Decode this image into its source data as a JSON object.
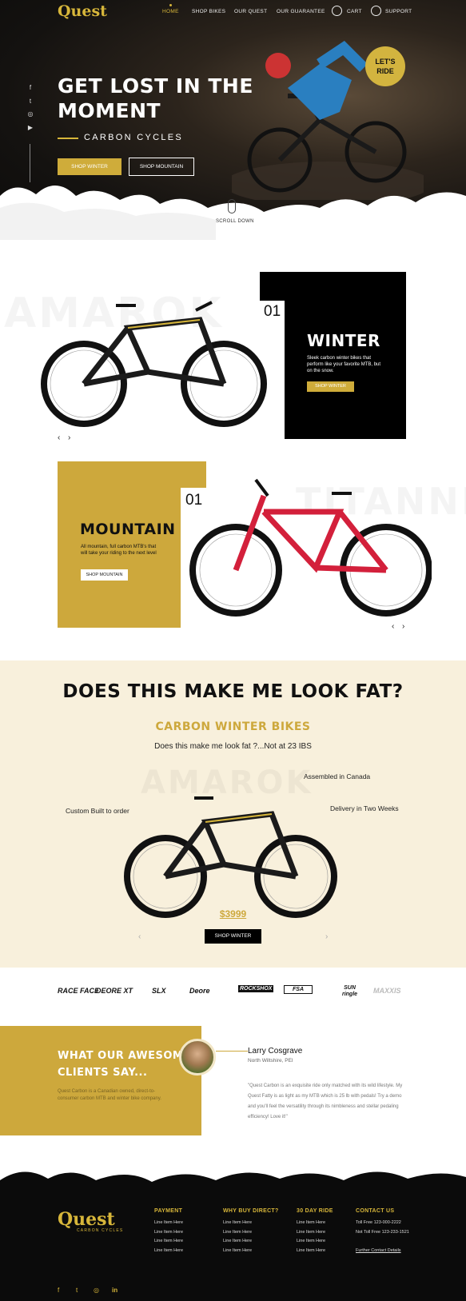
{
  "brand": {
    "logo_text": "Quest",
    "tagline": "CARBON CYCLES"
  },
  "nav": {
    "items": [
      "HOME",
      "SHOP BIKES",
      "OUR QUEST",
      "OUR GUARANTEE"
    ],
    "cart": "CART",
    "support": "SUPPORT"
  },
  "hero": {
    "title_line1": "GET LOST IN THE",
    "title_line2": "MOMENT",
    "subtitle": "CARBON CYCLES",
    "btn_winter": "SHOP WINTER",
    "btn_mountain": "SHOP MOUNTAIN",
    "badge_line1": "LET'S",
    "badge_line2": "RIDE",
    "scroll": "SCROLL DOWN",
    "social_icons": [
      "facebook-icon",
      "twitter-icon",
      "instagram-icon",
      "youtube-icon"
    ]
  },
  "winter": {
    "ghost": "AMAROK",
    "number": "01",
    "title": "WINTER",
    "text": "Sleek carbon winter bikes that perform like your favorite MTB, but on the snow.",
    "button": "SHOP WINTER"
  },
  "mountain": {
    "ghost": "TITANNI",
    "number": "01",
    "title": "MOUNTAIN",
    "text": "All mountain, full carbon MTB's that will take your riding to the next level",
    "button": "SHOP MOUNTAIN"
  },
  "fat": {
    "heading": "DOES THIS MAKE ME LOOK FAT?",
    "subheading": "CARBON WINTER BIKES",
    "tagline": "Does this make me look fat ?...Not at 23 IBS",
    "ghost": "AMAROK",
    "feature_left": "Custom Built to order",
    "feature_top": "Assembled in Canada",
    "feature_right": "Delivery in Two Weeks",
    "price": "$3999",
    "button": "SHOP WINTER"
  },
  "brands": [
    "RACE FACE",
    "DEORE XT",
    "SLX",
    "Deore",
    "ROCKSHOX",
    "FSA",
    "SUN ringle",
    "MAXXIS"
  ],
  "testimonial": {
    "heading_line1": "WHAT OUR AWESOME",
    "heading_line2": "CLIENTS SAY...",
    "intro": "Quest Carbon is a Canadian owned, direct-to-consumer carbon MTB and winter bike company.",
    "name": "Larry Cosgrave",
    "location": "North Wiltshire, PEI",
    "quote": "\"Quest Carbon is an exquisite ride only matched with its wild lifestyle. My Quest Fatty is as light as my MTB which is 25 lb with pedals! Try a demo and you'll feel the versatility through its nimbleness and stellar pedaling efficiency! Love it!\""
  },
  "footer": {
    "columns": [
      {
        "title": "PAYMENT",
        "items": [
          "Line Item Here",
          "Line Item Here",
          "Line Item Here",
          "Line Item Here"
        ]
      },
      {
        "title": "WHY BUY DIRECT?",
        "items": [
          "Line Item Here",
          "Line Item Here",
          "Line Item Here",
          "Line Item Here"
        ]
      },
      {
        "title": "30 DAY RIDE",
        "items": [
          "Line Item Here",
          "Line Item Here",
          "Line Item Here",
          "Line Item Here"
        ]
      },
      {
        "title": "CONTACT US",
        "items": [
          "Toll Free 123-000-2222",
          "Not Toll Free 123-233-1521",
          "",
          "Further Contact Details"
        ]
      }
    ]
  },
  "colors": {
    "accent": "#d7b63a",
    "dark": "#0b0b0b",
    "cream": "#f8f0dc"
  }
}
